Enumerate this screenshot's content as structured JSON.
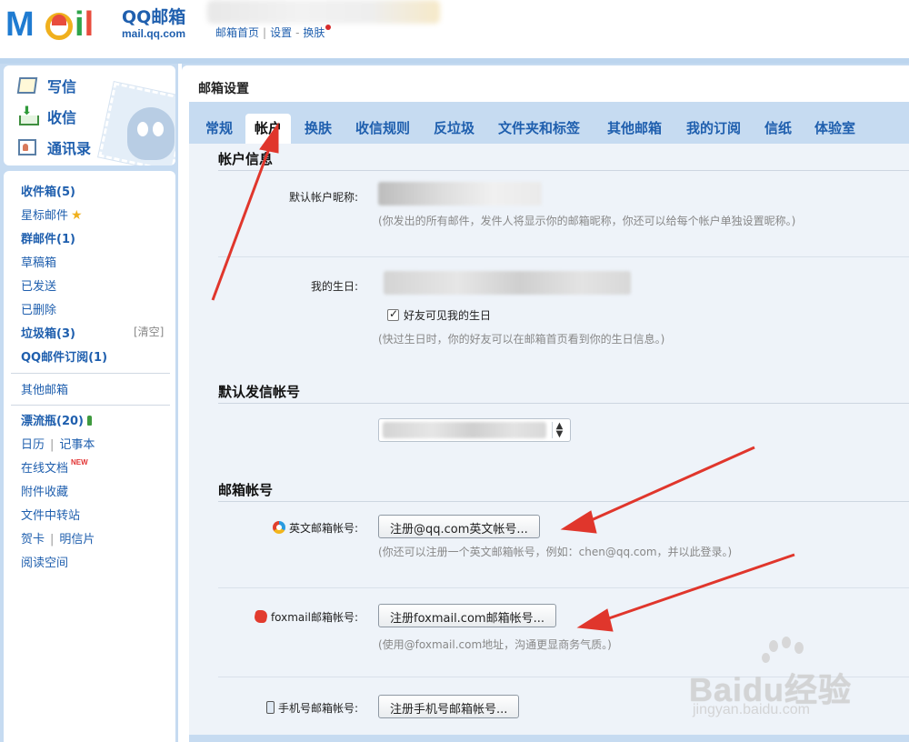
{
  "header": {
    "logo_letters": "MOil",
    "logo_cn": "QQ邮箱",
    "logo_en": "mail.qq.com",
    "links": [
      "邮箱首页",
      "设置",
      "换肤"
    ],
    "link_sep": "|",
    "link_dash": "-"
  },
  "sidebar": {
    "top": [
      {
        "label": "写信",
        "icon": "write-icon"
      },
      {
        "label": "收信",
        "icon": "inbox-icon"
      },
      {
        "label": "通讯录",
        "icon": "contacts-icon"
      }
    ],
    "items": [
      {
        "label": "收件箱(5)"
      },
      {
        "label": "星标邮件"
      },
      {
        "label": "群邮件(1)"
      },
      {
        "label": "草稿箱"
      },
      {
        "label": "已发送"
      },
      {
        "label": "已删除"
      },
      {
        "label": "垃圾箱(3)"
      },
      {
        "label": "QQ邮件订阅(1)"
      },
      {
        "label": "其他邮箱"
      },
      {
        "label": "漂流瓶(20)"
      },
      {
        "label": "日历"
      },
      {
        "label": "记事本"
      },
      {
        "label": "在线文档"
      },
      {
        "label": "附件收藏"
      },
      {
        "label": "文件中转站"
      },
      {
        "label": "贺卡"
      },
      {
        "label": "明信片"
      },
      {
        "label": "阅读空间"
      }
    ],
    "clear_label": "[清空]",
    "new_badge": "NEW",
    "pipe": "|"
  },
  "main": {
    "title": "邮箱设置",
    "tabs": [
      {
        "label": "常规"
      },
      {
        "label": "帐户",
        "active": true
      },
      {
        "label": "换肤"
      },
      {
        "label": "收信规则"
      },
      {
        "label": "反垃圾"
      },
      {
        "label": "文件夹和标签"
      },
      {
        "label": "其他邮箱"
      },
      {
        "label": "我的订阅"
      },
      {
        "label": "信纸"
      },
      {
        "label": "体验室"
      }
    ],
    "account_info": {
      "heading": "帐户信息",
      "nickname_label": "默认帐户昵称:",
      "nickname_hint": "(你发出的所有邮件，发件人将显示你的邮箱昵称，你还可以给每个帐户单独设置昵称。)",
      "birthday_label": "我的生日:",
      "birthday_checkbox": "好友可见我的生日",
      "birthday_checked": true,
      "birthday_hint": "(快过生日时，你的好友可以在邮箱首页看到你的生日信息。)"
    },
    "default_sender": {
      "heading": "默认发信帐号"
    },
    "mail_accounts": {
      "heading": "邮箱帐号",
      "english_label": "英文邮箱帐号:",
      "english_button": "注册@qq.com英文帐号...",
      "english_hint": "(你还可以注册一个英文邮箱帐号，例如：chen@qq.com，并以此登录。)",
      "foxmail_label": "foxmail邮箱帐号:",
      "foxmail_button": "注册foxmail.com邮箱帐号...",
      "foxmail_hint": "(使用@foxmail.com地址，沟通更显商务气质。)",
      "phone_label": "手机号邮箱帐号:",
      "phone_button": "注册手机号邮箱帐号..."
    }
  },
  "watermark": {
    "text": "Baidu经验",
    "sub": "jingyan.baidu.com"
  },
  "colors": {
    "link_blue": "#1f5fae",
    "panel_blue": "#c6dbf1",
    "content_bg": "#eef3f9",
    "annotation_red": "#e0362c"
  }
}
